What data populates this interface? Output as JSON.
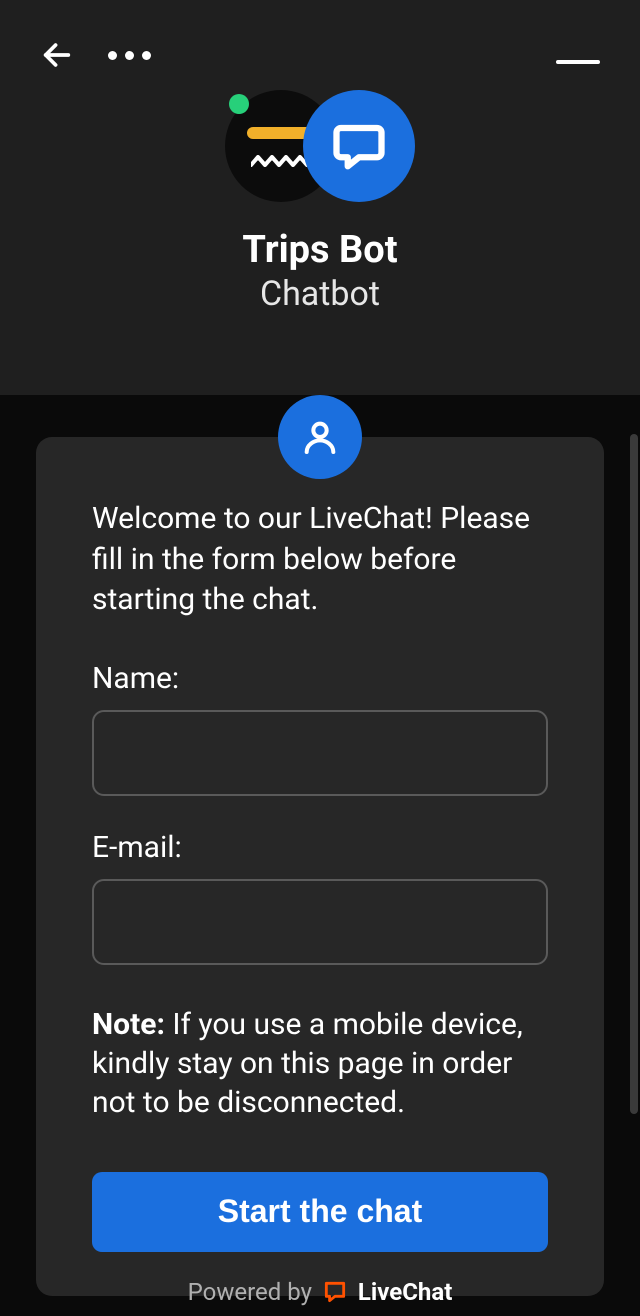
{
  "header": {
    "title": "Trips Bot",
    "subtitle": "Chatbot"
  },
  "form": {
    "welcome": "Welcome to our LiveChat! Please fill in the form below before starting the chat.",
    "name_label": "Name:",
    "name_value": "",
    "email_label": "E-mail:",
    "email_value": "",
    "note_prefix": "Note:",
    "note_text": " If you use a mobile device, kindly stay on this page in order not to be disconnected.",
    "submit_label": "Start the chat"
  },
  "footer": {
    "powered_by": "Powered by",
    "brand": "LiveChat"
  },
  "icons": {
    "back": "arrow-left-icon",
    "more": "more-horizontal-icon",
    "minimize": "minimize-icon",
    "chat_bubble": "chat-bubble-icon",
    "user": "user-icon",
    "livechat": "livechat-logo-icon",
    "presence": "presence-online-icon"
  },
  "colors": {
    "accent": "#1b6fde",
    "bg_header": "#1f1f1f",
    "bg_body": "#0a0a0a",
    "bg_card": "#272727",
    "presence": "#27d07a",
    "logo_yellow": "#f2b02a"
  }
}
